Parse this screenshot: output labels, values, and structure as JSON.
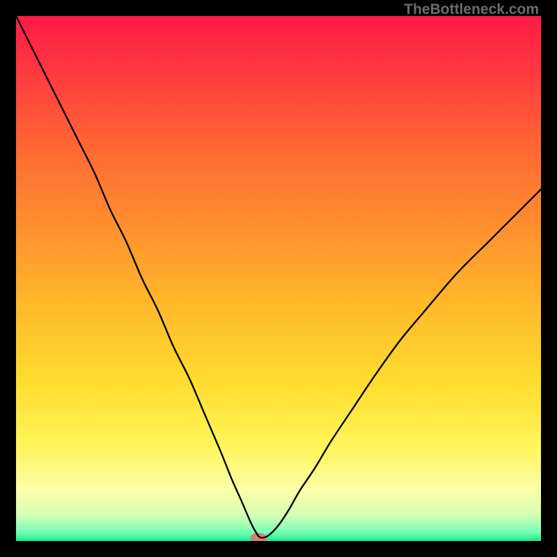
{
  "watermark": "TheBottleneck.com",
  "chart_data": {
    "type": "line",
    "title": "",
    "xlabel": "",
    "ylabel": "",
    "xlim": [
      0,
      100
    ],
    "ylim": [
      0,
      100
    ],
    "grid": false,
    "legend": false,
    "background_gradient": {
      "stops": [
        {
          "offset": 0.0,
          "color": "#ff1a47"
        },
        {
          "offset": 0.12,
          "color": "#ff3d3e"
        },
        {
          "offset": 0.26,
          "color": "#ff6a33"
        },
        {
          "offset": 0.4,
          "color": "#ff8f2e"
        },
        {
          "offset": 0.55,
          "color": "#ffb92a"
        },
        {
          "offset": 0.7,
          "color": "#ffdd2f"
        },
        {
          "offset": 0.82,
          "color": "#fff55a"
        },
        {
          "offset": 0.9,
          "color": "#fcffa6"
        },
        {
          "offset": 0.95,
          "color": "#d7ffb5"
        },
        {
          "offset": 0.985,
          "color": "#6fffb5"
        },
        {
          "offset": 1.0,
          "color": "#17e88b"
        }
      ]
    },
    "series": [
      {
        "name": "bottleneck-curve",
        "type": "line",
        "color": "#000000",
        "x": [
          0,
          3,
          6,
          9,
          12,
          15,
          18,
          21,
          24,
          27,
          30,
          33,
          36,
          39,
          41,
          43,
          44.5,
          45.5,
          46.5,
          48,
          50,
          52,
          54,
          57,
          60,
          64,
          68,
          73,
          78,
          84,
          90,
          96,
          100
        ],
        "y": [
          100,
          94,
          88,
          82,
          76,
          70,
          63,
          57,
          50,
          44,
          37,
          31,
          24,
          17,
          12,
          7.5,
          4.0,
          2.0,
          0.7,
          1.0,
          3.0,
          6.0,
          9.5,
          14,
          19,
          25,
          31,
          38,
          44,
          51,
          57,
          63,
          67
        ]
      }
    ],
    "marker": {
      "name": "optimum-marker",
      "x": 46.2,
      "y": 0.6,
      "color": "#d97f77",
      "rx": 12,
      "ry": 7
    }
  }
}
